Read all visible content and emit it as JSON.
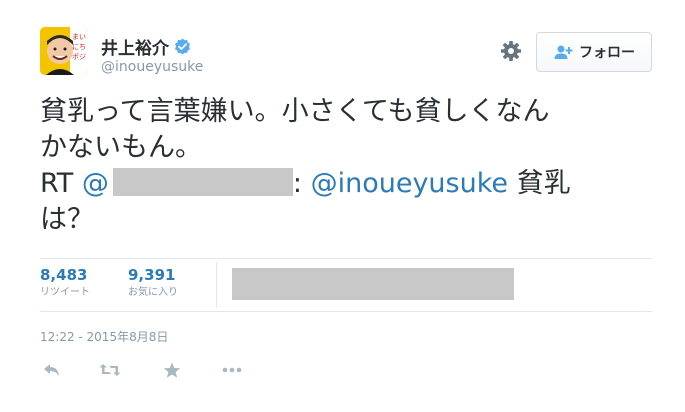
{
  "profile": {
    "fullname": "井上裕介",
    "username": "@inoueyusuke",
    "avatar_text": "まいにちポジティブ!"
  },
  "header": {
    "follow_label": "フォロー",
    "gear_icon": "gear-icon",
    "follow_icon": "follow-user-icon",
    "verified_icon": "verified-badge-icon"
  },
  "tweet": {
    "line1": "貧乳って言葉嫌い。小さくても貧しくなん",
    "line2": "かないもん。",
    "rt_prefix": "RT",
    "mention_at": "@",
    "colon": ":",
    "mention_user": "@inoueyusuke",
    "rt_tail": " 貧乳",
    "line4": "は？"
  },
  "stats": {
    "retweets": "8,483",
    "retweets_label": "リツイート",
    "favorites": "9,391",
    "favorites_label": "お気に入り"
  },
  "timestamp": "12:22 - 2015年8月8日",
  "actions": [
    "reply-icon",
    "retweet-icon",
    "favorite-star-icon",
    "more-dots-icon"
  ],
  "colors": {
    "link": "#2b7bb9",
    "muted": "#8899a6",
    "text": "#292f33",
    "verified": "#55acee",
    "redaction": "#c8c8c8"
  }
}
